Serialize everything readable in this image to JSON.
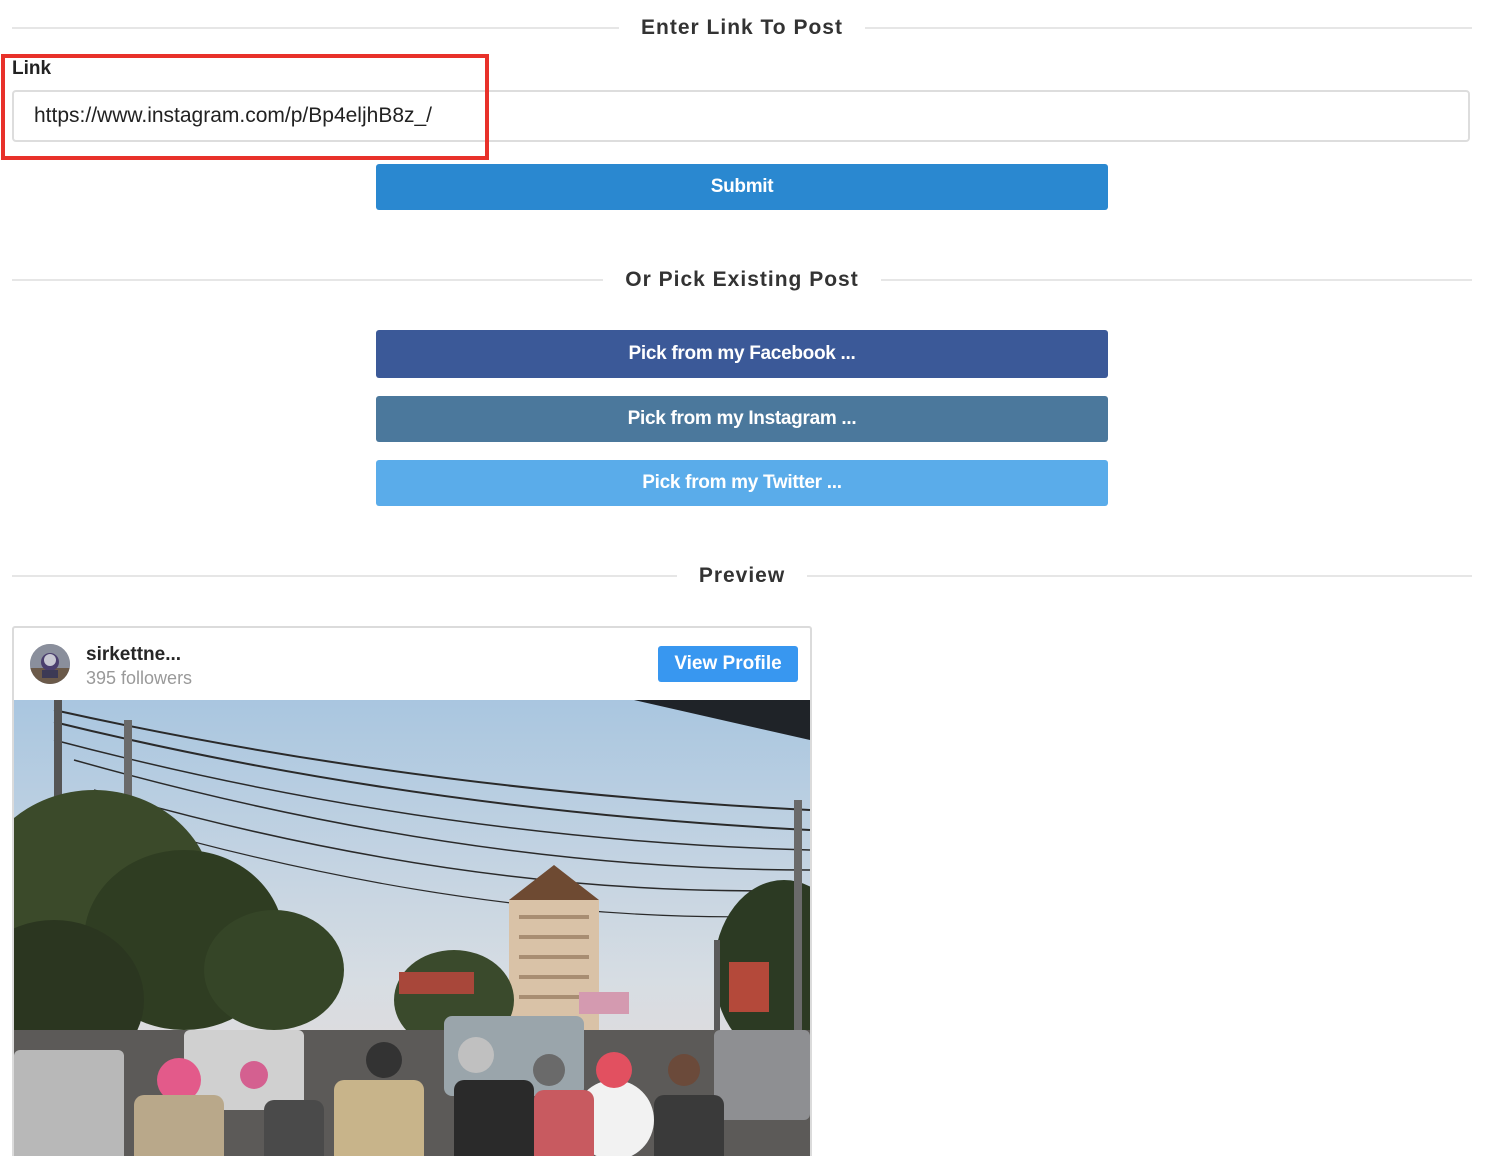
{
  "sections": {
    "enter_link_title": "Enter Link To Post",
    "pick_title": "Or Pick Existing Post",
    "preview_title": "Preview"
  },
  "link_field": {
    "label": "Link",
    "value": "https://www.instagram.com/p/Bp4eljhB8z_/"
  },
  "buttons": {
    "submit": "Submit",
    "facebook": "Pick from my Facebook ...",
    "instagram": "Pick from my Instagram ...",
    "twitter": "Pick from my Twitter ..."
  },
  "preview": {
    "username": "sirkettne...",
    "followers": "395 followers",
    "view_profile": "View Profile"
  },
  "colors": {
    "submit": "#2a88d0",
    "facebook": "#3b5998",
    "instagram": "#4b789c",
    "twitter": "#5aacea",
    "view_profile": "#3897f0",
    "highlight": "#e8312a"
  }
}
